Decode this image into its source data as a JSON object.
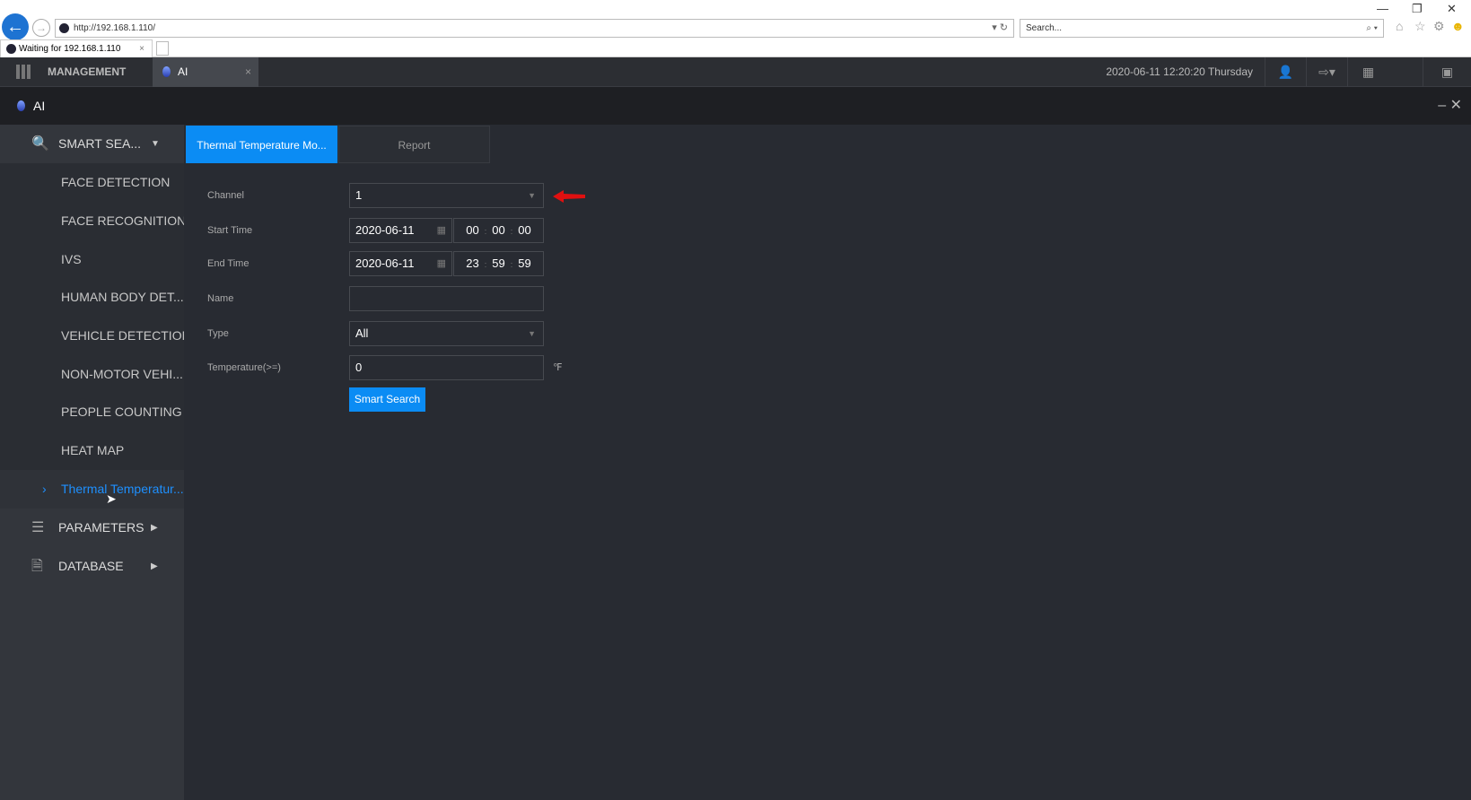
{
  "browser": {
    "url": "http://192.168.1.110/",
    "search_placeholder": "Search...",
    "tab_title": "Waiting for 192.168.1.110"
  },
  "appbar": {
    "management": "MANAGEMENT",
    "tab": "AI",
    "datetime": "2020-06-11 12:20:20 Thursday"
  },
  "window": {
    "title": "AI"
  },
  "sidebar": {
    "smart_search": "SMART SEA...",
    "items": [
      "FACE DETECTION",
      "FACE RECOGNITION",
      "IVS",
      "HUMAN BODY DET...",
      "VEHICLE DETECTION",
      "NON-MOTOR VEHI...",
      "PEOPLE COUNTING",
      "HEAT MAP",
      "Thermal Temperatur..."
    ],
    "parameters": "PARAMETERS",
    "database": "DATABASE"
  },
  "tabs": [
    "Thermal Temperature Mo...",
    "Report"
  ],
  "form": {
    "channel_label": "Channel",
    "channel": "1",
    "start_label": "Start Time",
    "start_date": "2020-06-11",
    "start_h": "00",
    "start_m": "00",
    "start_s": "00",
    "end_label": "End Time",
    "end_date": "2020-06-11",
    "end_h": "23",
    "end_m": "59",
    "end_s": "59",
    "name_label": "Name",
    "name": "",
    "type_label": "Type",
    "type": "All",
    "temp_label": "Temperature(>=)",
    "temp": "0",
    "unit": "℉",
    "search_button": "Smart Search"
  },
  "colors": {
    "accent": "#0b8cf4",
    "arrow": "#e01010"
  }
}
